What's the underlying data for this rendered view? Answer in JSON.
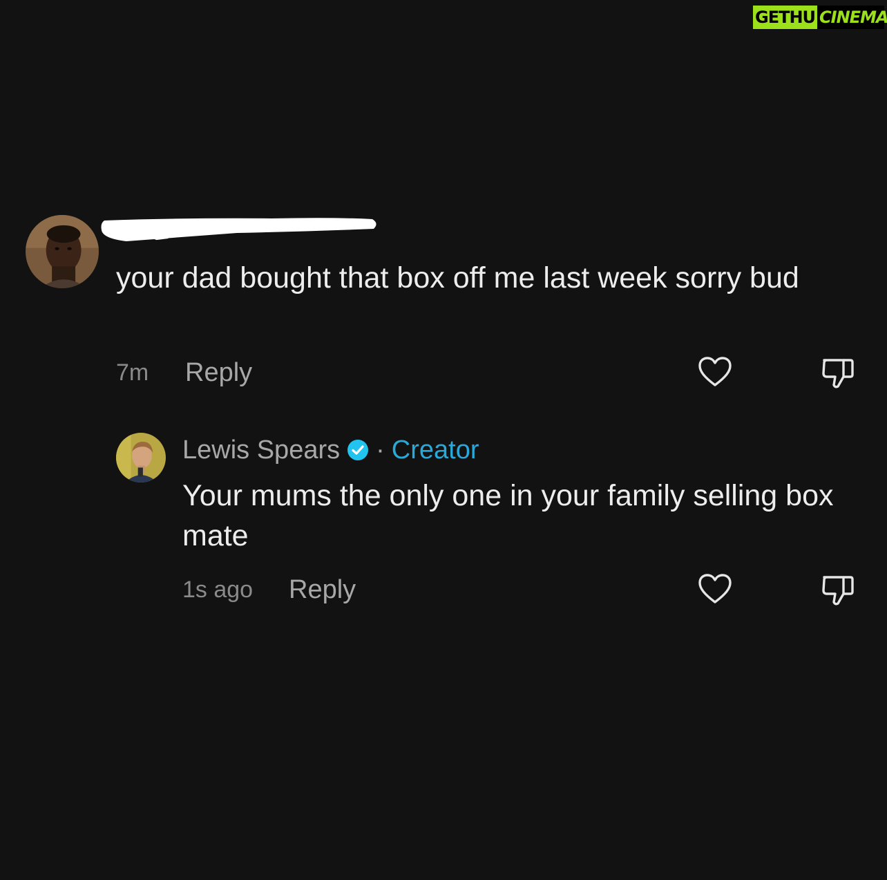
{
  "watermark": {
    "left_text": "GETHU",
    "right_text": "CINEMA"
  },
  "colors": {
    "background": "#121212",
    "text": "#ededed",
    "muted": "#a8a8a8",
    "creator_accent": "#2aa8d8",
    "watermark_green": "#9be01a"
  },
  "comments": [
    {
      "author": "",
      "author_redacted": true,
      "text": "your dad bought that box off me last week sorry bud",
      "time": "7m",
      "reply_label": "Reply",
      "like_icon": "heart-outline",
      "dislike_icon": "thumbs-down-outline"
    },
    {
      "author": "Lewis Spears",
      "verified": true,
      "separator": "·",
      "badge": "Creator",
      "text": "Your mums the only one in your family selling box mate",
      "time": "1s ago",
      "reply_label": "Reply",
      "like_icon": "heart-outline",
      "dislike_icon": "thumbs-down-outline"
    }
  ]
}
